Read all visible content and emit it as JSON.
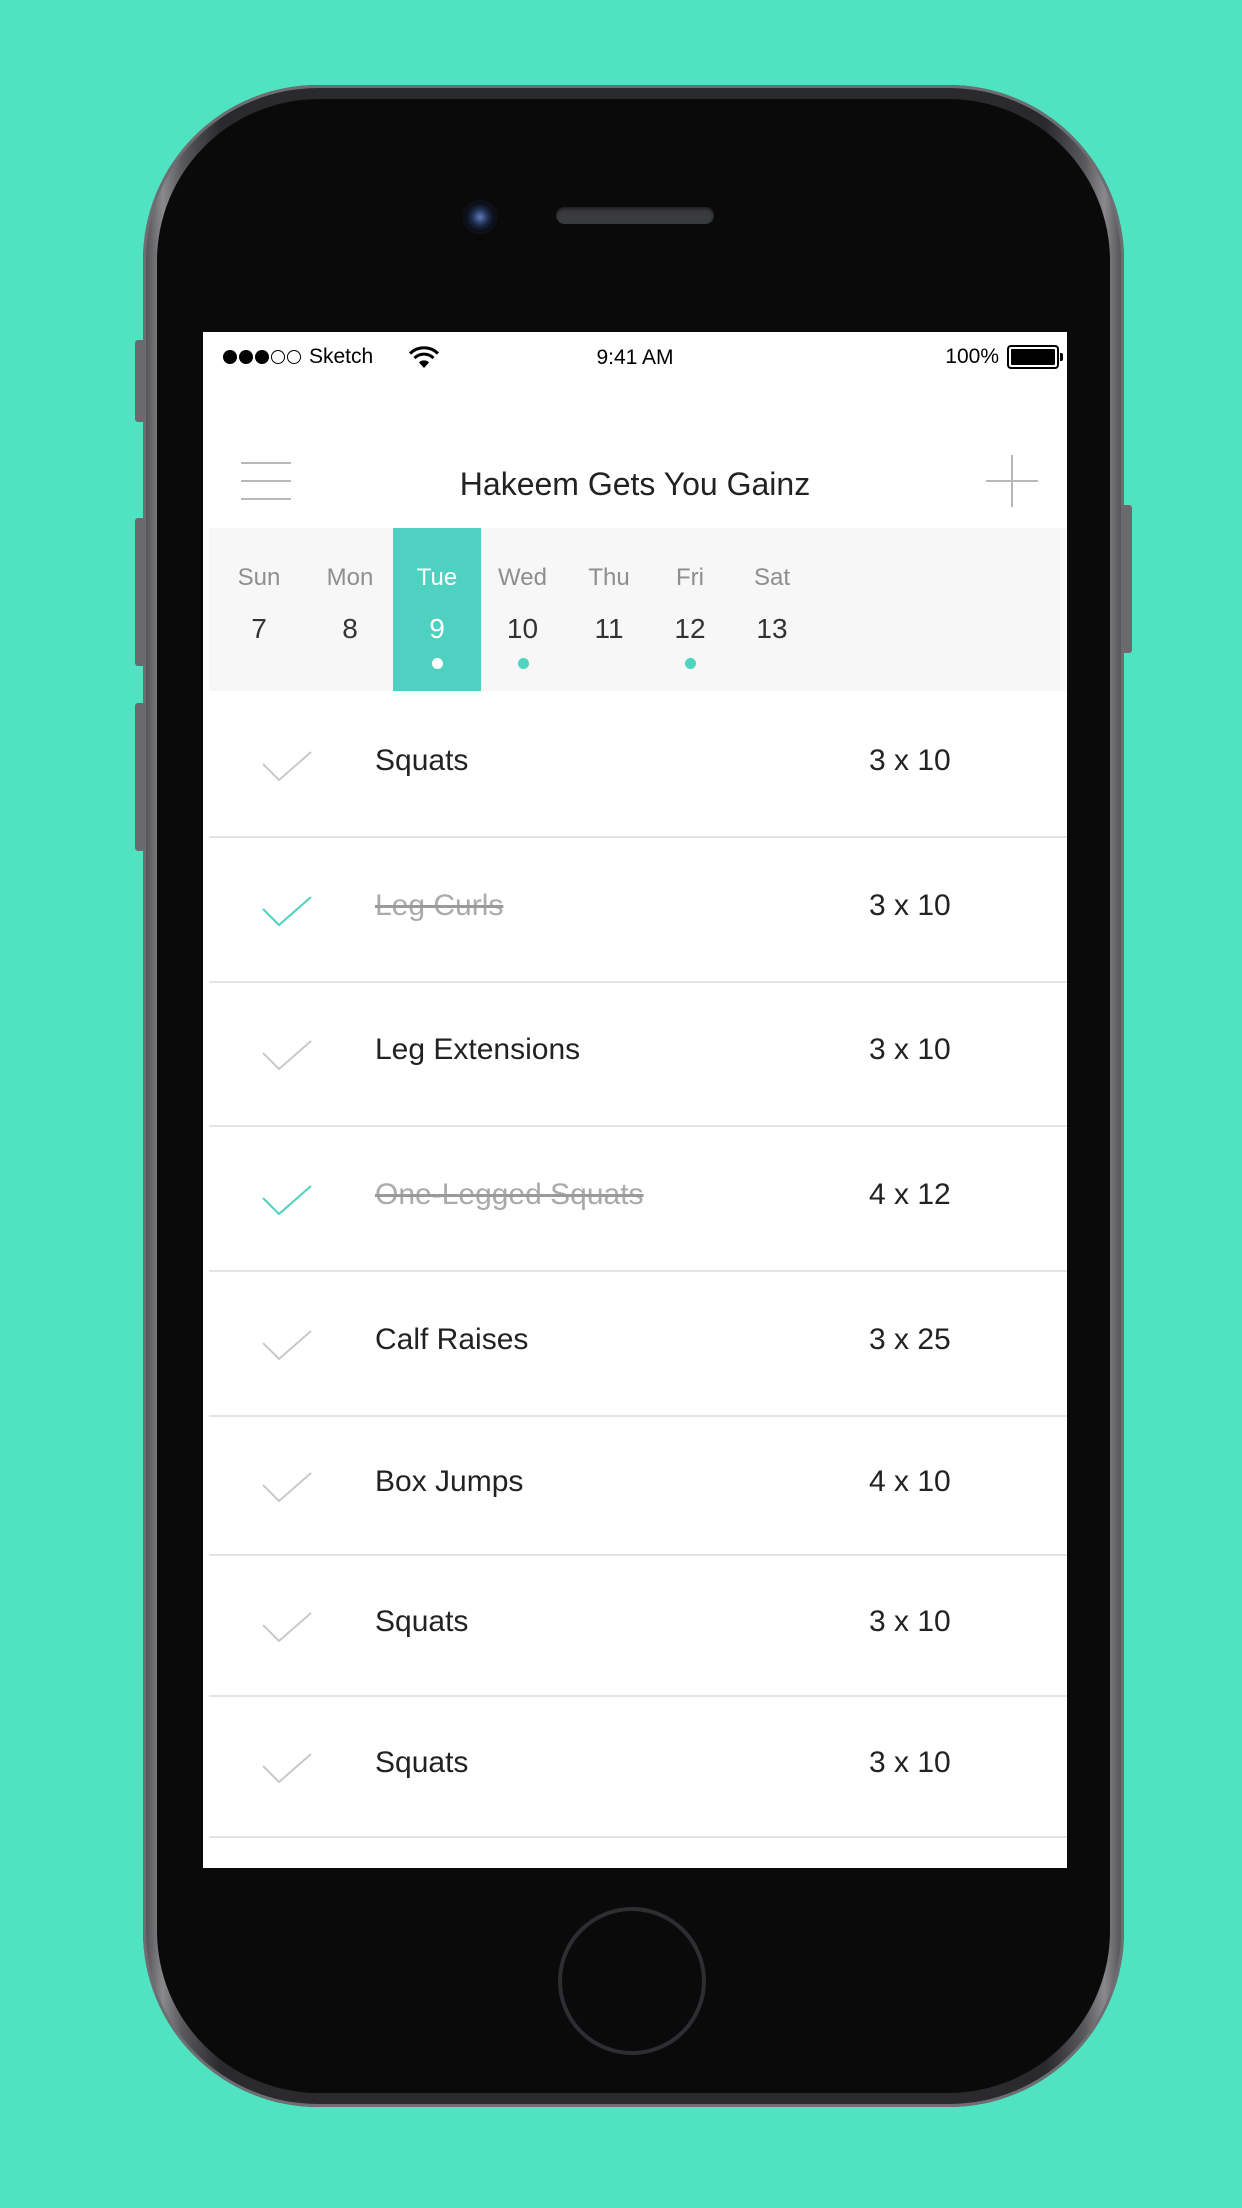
{
  "colors": {
    "background": "#50E3C2",
    "accent": "#4ED1C0",
    "done_check": "#4ED1C0",
    "pending_check": "#c9c9c9"
  },
  "status_bar": {
    "carrier": "Sketch",
    "time": "9:41 AM",
    "battery": "100%",
    "signal_full": 3,
    "signal_empty": 2
  },
  "nav": {
    "title": "Hakeem Gets You Gainz",
    "menu_icon": "hamburger-menu-icon",
    "add_icon": "plus-icon"
  },
  "week": [
    {
      "name": "Sun",
      "num": "7",
      "active": false,
      "event": false
    },
    {
      "name": "Mon",
      "num": "8",
      "active": false,
      "event": false
    },
    {
      "name": "Tue",
      "num": "9",
      "active": true,
      "event": true
    },
    {
      "name": "Wed",
      "num": "10",
      "active": false,
      "event": true
    },
    {
      "name": "Thu",
      "num": "11",
      "active": false,
      "event": false
    },
    {
      "name": "Fri",
      "num": "12",
      "active": false,
      "event": true
    },
    {
      "name": "Sat",
      "num": "13",
      "active": false,
      "event": false
    }
  ],
  "exercises": [
    {
      "name": "Squats",
      "sets": "3 x 10",
      "done": false
    },
    {
      "name": "Leg Curls",
      "sets": "3 x 10",
      "done": true
    },
    {
      "name": "Leg Extensions",
      "sets": "3 x 10",
      "done": false
    },
    {
      "name": "One-Legged Squats",
      "sets": "4 x 12",
      "done": true
    },
    {
      "name": "Calf Raises",
      "sets": "3 x 25",
      "done": false
    },
    {
      "name": "Box Jumps",
      "sets": "4 x 10",
      "done": false
    },
    {
      "name": "Squats",
      "sets": "3 x 10",
      "done": false
    },
    {
      "name": "Squats",
      "sets": "3 x 10",
      "done": false
    }
  ]
}
